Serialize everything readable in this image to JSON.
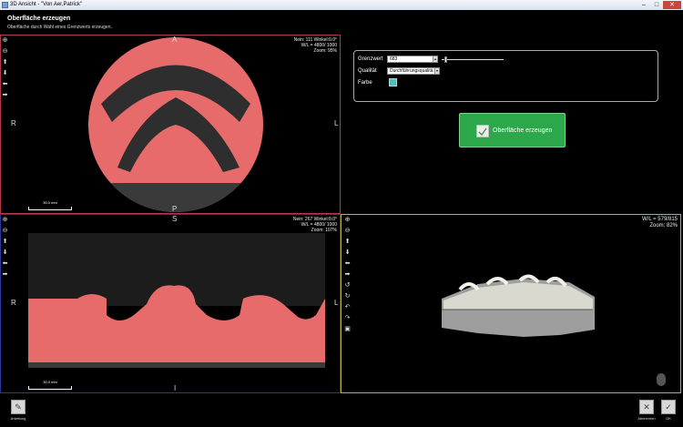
{
  "window": {
    "title": "3D Ansicht - \"Von Aer,Patrick\"",
    "min": "–",
    "max": "□",
    "close": "✕"
  },
  "header": {
    "title": "Oberfläche erzeugen",
    "subtitle": "Oberfläche durch Wahl eines Grenzwerts erzeugen."
  },
  "axial": {
    "info": [
      "Nein: 111 Winkel:0.0°",
      "W/L = 4800/ 1000",
      "Zoom: 95%"
    ],
    "top": "A",
    "bottom": "P",
    "left": "R",
    "right": "L",
    "scale": "30.0 mm"
  },
  "coronal": {
    "info": [
      "Nein: 267 Winkel:0.0°",
      "W/L = 4800/ 1000",
      "Zoom: 107%"
    ],
    "top": "S",
    "bottom": "I",
    "left": "R",
    "right": "L",
    "scale": "30.0 mm"
  },
  "view3d": {
    "info": [
      "W/L = 579/815",
      "Zoom: 82%"
    ]
  },
  "settings": {
    "threshold_label": "Grenzwert",
    "threshold_value": "683",
    "threshold_slider_fraction": 0.05,
    "quality_label": "Qualität",
    "quality_value": "Durchführungsqualitä",
    "color_label": "Farbe",
    "color_value": "#4fbfbf"
  },
  "create_button": {
    "label": "Oberfläche erzeugen"
  },
  "tools": {
    "icons": [
      "zoom-in-icon",
      "zoom-out-icon",
      "arrow-up-icon",
      "arrow-down-icon",
      "arrow-left-icon",
      "arrow-right-icon"
    ],
    "glyphs": [
      "⊕",
      "⊖",
      "⬆",
      "⬇",
      "⬅",
      "➡"
    ],
    "icons3d": [
      "zoom-in-icon",
      "zoom-out-icon",
      "arrow-up-icon",
      "arrow-down-icon",
      "arrow-left-icon",
      "arrow-right-icon",
      "rotate-left-icon",
      "rotate-right-icon",
      "rotate-up-icon",
      "rotate-down-icon",
      "camera-icon"
    ],
    "glyphs3d": [
      "⊕",
      "⊖",
      "⬆",
      "⬇",
      "⬅",
      "➡",
      "↺",
      "↻",
      "↶",
      "↷",
      "▣"
    ]
  },
  "footer": {
    "help_label": "Anleitung",
    "cancel_label": "Abbrechen",
    "ok_label": "OK"
  }
}
